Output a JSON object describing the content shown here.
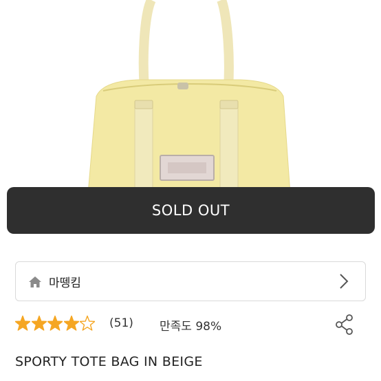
{
  "product_image": {
    "icon": "product-photo-yellow-tote-bag"
  },
  "sold_out": {
    "label": "SOLD OUT"
  },
  "store": {
    "icon": "home-icon",
    "name": "마뗑킴",
    "chevron": "chevron-right-icon"
  },
  "rating": {
    "stars_filled": 4,
    "stars_total": 5,
    "count": "(51)",
    "satisfaction": "만족도 98%",
    "star_color": "#f5a623",
    "share_icon": "share-icon"
  },
  "product": {
    "title": "SPORTY TOTE BAG IN BEIGE"
  },
  "colors": {
    "sold_out_bg": "#2f2f2f",
    "bag_yellow": "#f3e9a4"
  }
}
